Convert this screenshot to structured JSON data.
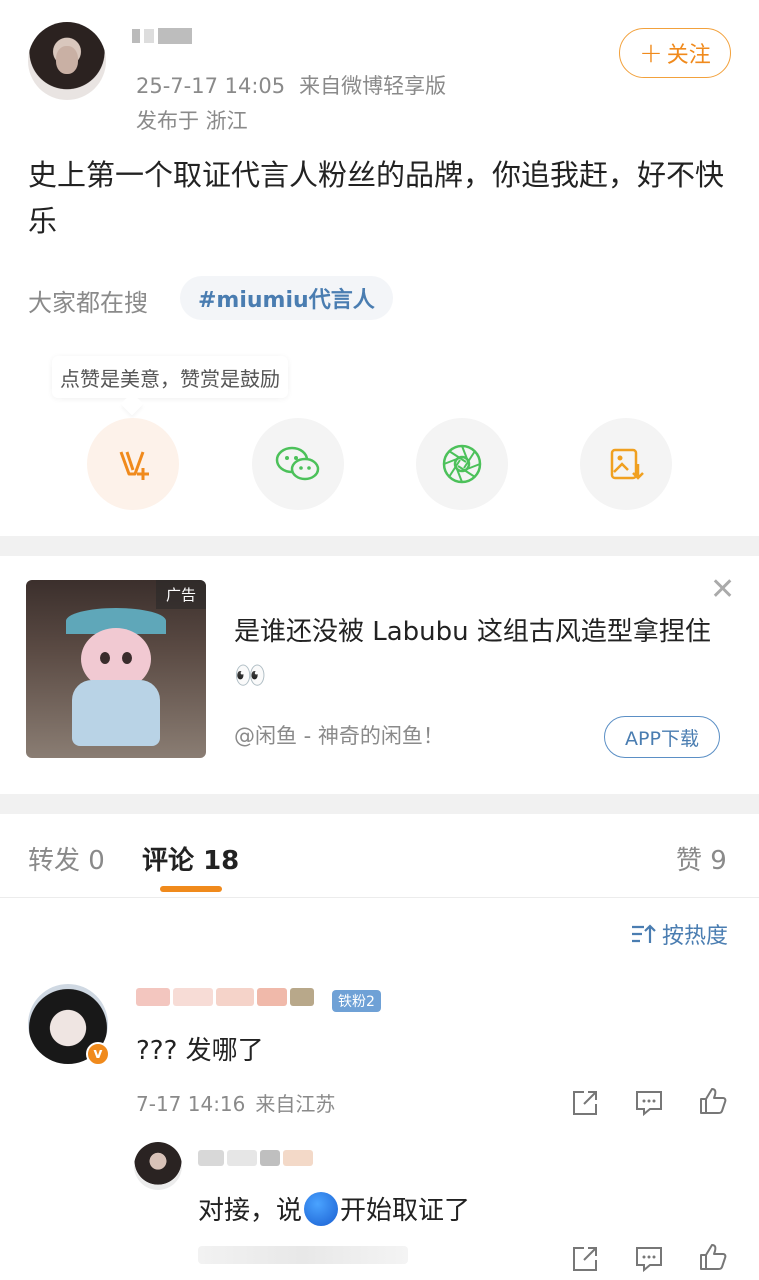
{
  "post": {
    "timestamp": "25-7-17 14:05",
    "source": "来自微博轻享版",
    "location": "发布于 浙江",
    "follow_label": "关注",
    "text": "史上第一个取证代言人粉丝的品牌，你追我赶，好不快乐",
    "search_label": "大家都在搜",
    "hashtag": "#miumiu代言人",
    "reward_tip": "点赞是美意，赞赏是鼓励"
  },
  "ad": {
    "tag": "广告",
    "title": "是谁还没被 Labubu 这组古风造型拿捏住👀",
    "source": "@闲鱼 - 神奇的闲鱼！",
    "button_label": "APP下载"
  },
  "tabs": {
    "repost_label": "转发",
    "repost_count": "0",
    "comment_label": "评论",
    "comment_count": "18",
    "like_label": "赞",
    "like_count": "9"
  },
  "sort_label": "按热度",
  "comment": {
    "fan_badge": "铁粉2",
    "verified_badge": "v",
    "text": "??? 发哪了",
    "time": "7-17 14:16",
    "location": "来自江苏"
  },
  "reply": {
    "text_before": "对接，说",
    "text_after": "开始取证了"
  },
  "colors": {
    "accent": "#f08a1c",
    "link": "#4a7db1",
    "wechat_green": "#4cc15a"
  }
}
